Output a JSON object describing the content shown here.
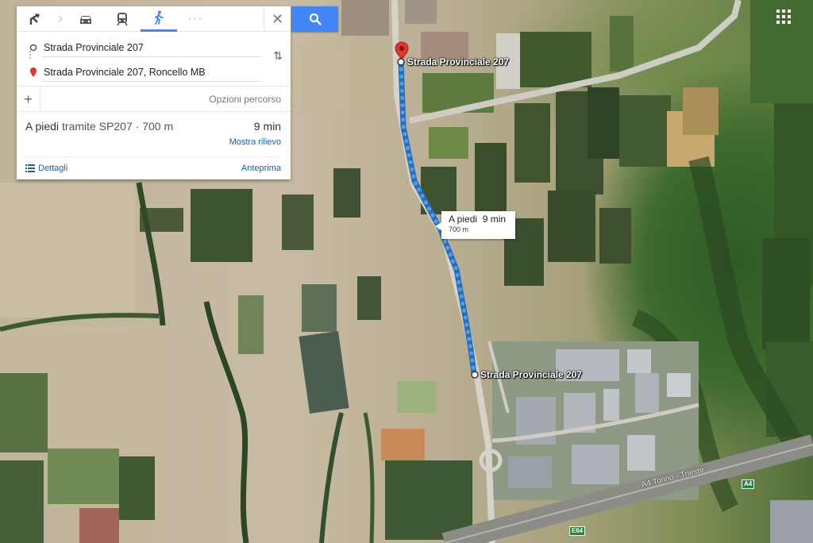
{
  "panel": {
    "modes": [
      {
        "name": "directions",
        "icon": "route-arrow-icon"
      },
      {
        "name": "car",
        "icon": "car-icon"
      },
      {
        "name": "transit",
        "icon": "train-icon"
      },
      {
        "name": "walk",
        "icon": "walk-icon",
        "active": true
      },
      {
        "name": "more",
        "icon": "more-dots-icon"
      }
    ],
    "origin": "Strada Provinciale 207",
    "destination": "Strada Provinciale 207, Roncello MB",
    "options_label": "Opzioni percorso",
    "route": {
      "mode_label": "A piedi",
      "via": "tramite SP207 · 700 m",
      "duration": "9 min",
      "relief_link": "Mostra rilievo",
      "details_label": "Dettagli",
      "preview_label": "Anteprima"
    }
  },
  "map": {
    "origin_label": "Strada Provinciale 207",
    "destination_label": "Strada Provinciale 207",
    "bubble": {
      "mode": "A piedi",
      "duration": "9 min",
      "distance": "700 m"
    },
    "highway_label": "A4 Torino - Trieste",
    "shield_a4": "A4",
    "shield_e64": "E64",
    "route_color": "#4aa3ea"
  }
}
